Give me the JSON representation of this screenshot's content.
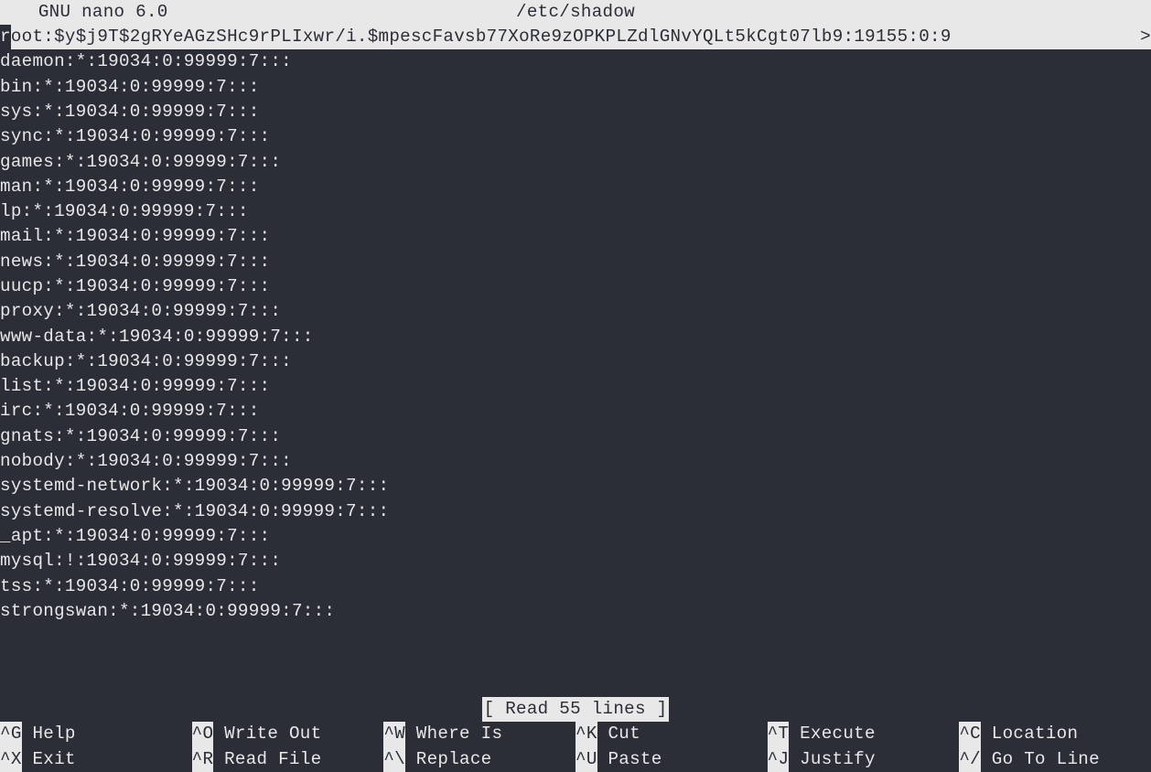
{
  "titleBar": {
    "appName": " GNU nano 6.0",
    "fileName": "/etc/shadow"
  },
  "highlightedLine": {
    "cursorChar": "r",
    "rest": "oot:$y$j9T$2gRYeAGzSHc9rPLIxwr/i.$mpescFavsb77XoRe9zOPKPLZdlGNvYQLt5kCgt07lb9:19155:0:9",
    "continuation": ">"
  },
  "lines": [
    "daemon:*:19034:0:99999:7:::",
    "bin:*:19034:0:99999:7:::",
    "sys:*:19034:0:99999:7:::",
    "sync:*:19034:0:99999:7:::",
    "games:*:19034:0:99999:7:::",
    "man:*:19034:0:99999:7:::",
    "lp:*:19034:0:99999:7:::",
    "mail:*:19034:0:99999:7:::",
    "news:*:19034:0:99999:7:::",
    "uucp:*:19034:0:99999:7:::",
    "proxy:*:19034:0:99999:7:::",
    "www-data:*:19034:0:99999:7:::",
    "backup:*:19034:0:99999:7:::",
    "list:*:19034:0:99999:7:::",
    "irc:*:19034:0:99999:7:::",
    "gnats:*:19034:0:99999:7:::",
    "nobody:*:19034:0:99999:7:::",
    "systemd-network:*:19034:0:99999:7:::",
    "systemd-resolve:*:19034:0:99999:7:::",
    "_apt:*:19034:0:99999:7:::",
    "mysql:!:19034:0:99999:7:::",
    "tss:*:19034:0:99999:7:::",
    "strongswan:*:19034:0:99999:7:::"
  ],
  "statusBar": {
    "text": "[ Read 55 lines ]"
  },
  "shortcuts": {
    "row1": [
      {
        "key": "^G",
        "label": " Help"
      },
      {
        "key": "^O",
        "label": " Write Out"
      },
      {
        "key": "^W",
        "label": " Where Is"
      },
      {
        "key": "^K",
        "label": " Cut"
      },
      {
        "key": "^T",
        "label": " Execute"
      },
      {
        "key": "^C",
        "label": " Location"
      }
    ],
    "row2": [
      {
        "key": "^X",
        "label": " Exit"
      },
      {
        "key": "^R",
        "label": " Read File"
      },
      {
        "key": "^\\",
        "label": " Replace"
      },
      {
        "key": "^U",
        "label": " Paste"
      },
      {
        "key": "^J",
        "label": " Justify"
      },
      {
        "key": "^/",
        "label": " Go To Line"
      }
    ]
  }
}
